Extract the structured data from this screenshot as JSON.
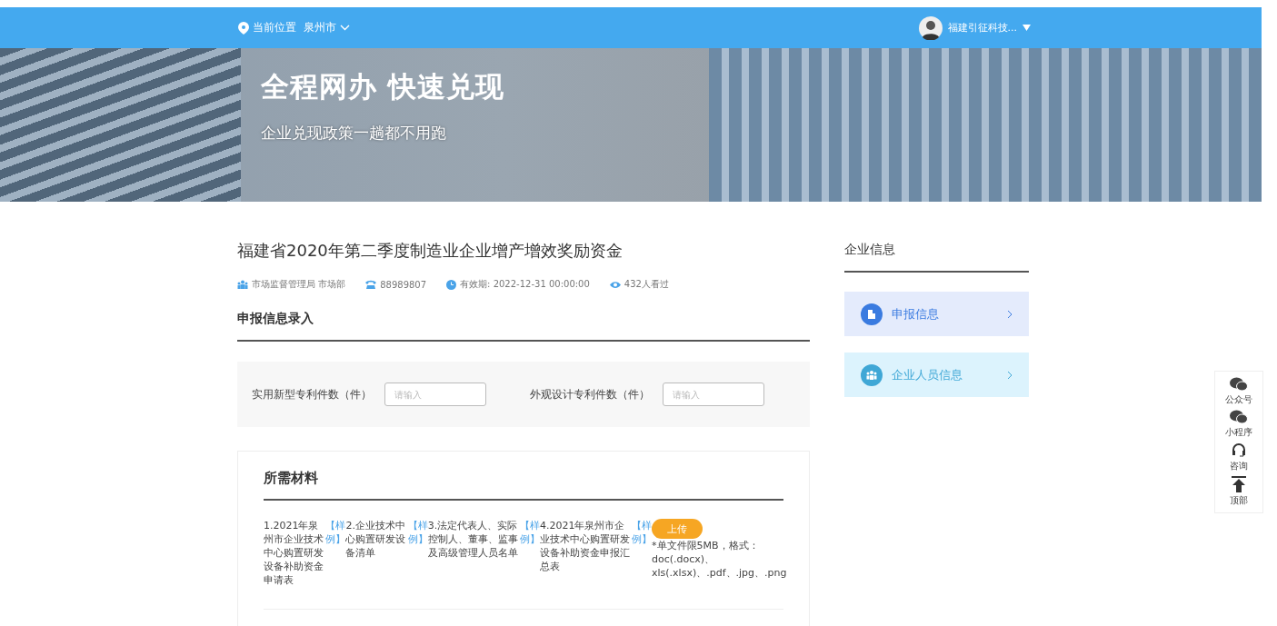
{
  "top_bar": {
    "location_label": "当前位置",
    "city": "泉州市",
    "user_name": "福建引征科技..."
  },
  "banner": {
    "title": "全程网办 快速兑现",
    "subtitle": "企业兑现政策一趟都不用跑"
  },
  "policy": {
    "title": "福建省2020年第二季度制造业企业增产增效奖励资金",
    "department": "市场监督管理局 市场部",
    "phone": "88989807",
    "validity": "有效期: 2022-12-31 00:00:00",
    "views": "432人看过"
  },
  "entry": {
    "heading": "申报信息录入",
    "fields": [
      {
        "label": "实用新型专利件数（件）",
        "placeholder": "请输入"
      },
      {
        "label": "外观设计专利件数（件）",
        "placeholder": "请输入"
      }
    ]
  },
  "materials": {
    "heading": "所需材料",
    "items": [
      {
        "name": "1.2021年泉州市企业技术中心购置研发设备补助资金申请表",
        "sample": "【样例】"
      },
      {
        "name": "2.企业技术中心购置研发设备清单",
        "sample": "【样例】"
      },
      {
        "name": "3.法定代表人、实际控制人、董事、监事及高级管理人员名单",
        "sample": "【样例】"
      },
      {
        "name": "4.2021年泉州市企业技术中心购置研发设备补助资金申报汇总表",
        "sample": "【样例】"
      }
    ],
    "upload_button": "上传",
    "note": "*单文件限5MB，格式：doc(.docx)、xls(.xlsx)、.pdf、.jpg、.png"
  },
  "company_info": {
    "heading": "企业信息",
    "links": [
      {
        "label": "申报信息",
        "kind": "report",
        "color": "#3a7be0"
      },
      {
        "label": "企业人员信息",
        "kind": "staff",
        "color": "#3fa7d6"
      }
    ]
  },
  "float_bar": [
    {
      "label": "公众号",
      "kind": "wechat"
    },
    {
      "label": "小程序",
      "kind": "wechat"
    },
    {
      "label": "咨询",
      "kind": "headset"
    },
    {
      "label": "顶部",
      "kind": "top"
    }
  ]
}
